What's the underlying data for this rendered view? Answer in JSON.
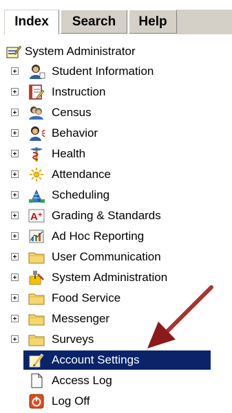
{
  "tabs": [
    {
      "label": "Index",
      "active": true
    },
    {
      "label": "Search",
      "active": false
    },
    {
      "label": "Help",
      "active": false
    }
  ],
  "tree": {
    "root_label": "System Administrator",
    "items": [
      {
        "label": "Student Information",
        "icon": "student-information-icon",
        "expandable": true
      },
      {
        "label": "Instruction",
        "icon": "instruction-icon",
        "expandable": true
      },
      {
        "label": "Census",
        "icon": "census-icon",
        "expandable": true
      },
      {
        "label": "Behavior",
        "icon": "behavior-icon",
        "expandable": true
      },
      {
        "label": "Health",
        "icon": "health-icon",
        "expandable": true
      },
      {
        "label": "Attendance",
        "icon": "attendance-icon",
        "expandable": true
      },
      {
        "label": "Scheduling",
        "icon": "scheduling-icon",
        "expandable": true
      },
      {
        "label": "Grading & Standards",
        "icon": "grading-icon",
        "expandable": true
      },
      {
        "label": "Ad Hoc Reporting",
        "icon": "ad-hoc-reporting-icon",
        "expandable": true
      },
      {
        "label": "User Communication",
        "icon": "folder-icon",
        "expandable": true
      },
      {
        "label": "System Administration",
        "icon": "system-administration-icon",
        "expandable": true
      },
      {
        "label": "Food Service",
        "icon": "folder-icon",
        "expandable": true
      },
      {
        "label": "Messenger",
        "icon": "folder-icon",
        "expandable": true
      },
      {
        "label": "Surveys",
        "icon": "folder-icon",
        "expandable": true
      },
      {
        "label": "Account Settings",
        "icon": "account-settings-icon",
        "expandable": false,
        "selected": true
      },
      {
        "label": "Access Log",
        "icon": "document-icon",
        "expandable": false
      },
      {
        "label": "Log Off",
        "icon": "log-off-icon",
        "expandable": false
      }
    ]
  },
  "colors": {
    "selection": "#0a246a",
    "tab_inactive": "#d4d0c8",
    "arrow": "#a52a2a",
    "folder": "#f5d76e"
  }
}
